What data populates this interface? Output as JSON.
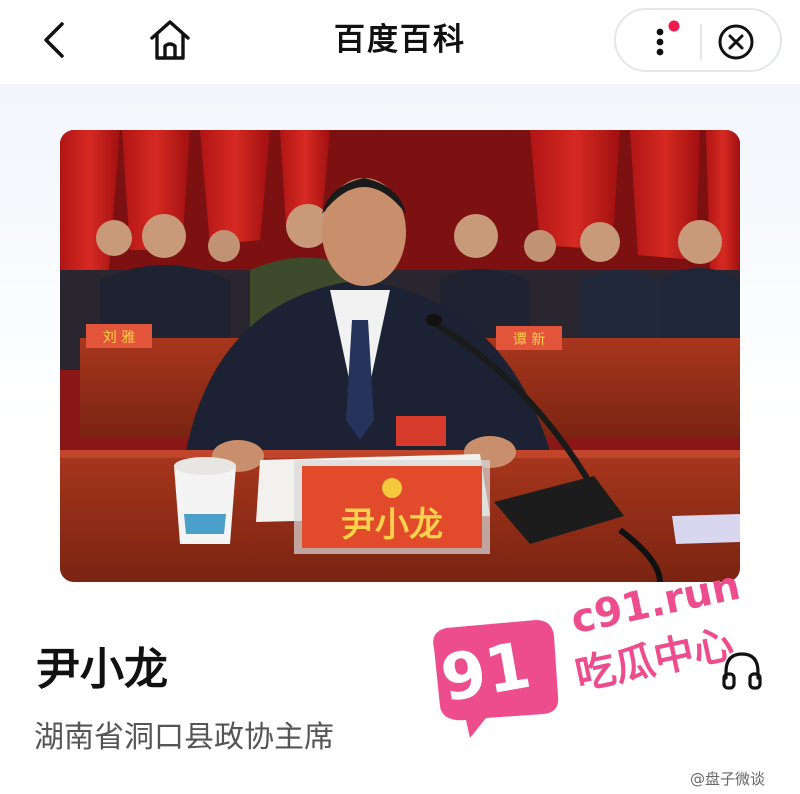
{
  "header": {
    "title": "百度百科",
    "back_icon": "chevron-left-icon",
    "home_icon": "home-icon",
    "more_icon": "more-vertical-icon",
    "close_icon": "close-circle-icon",
    "notification_dot_color": "#f0194c"
  },
  "entry": {
    "name": "尹小龙",
    "subtitle": "湖南省洞口县政协主席",
    "audio_icon": "headphones-icon",
    "photo": {
      "nameplate_text": "尹小龙",
      "background_nameplates": [
        "刘 雅",
        "谭 新"
      ]
    }
  },
  "watermark": {
    "badge_number": "91",
    "domain": "c91.run",
    "tagline": "吃瓜中心",
    "color": "#ee4d8d"
  },
  "credit": {
    "text": "@盘子微谈"
  }
}
